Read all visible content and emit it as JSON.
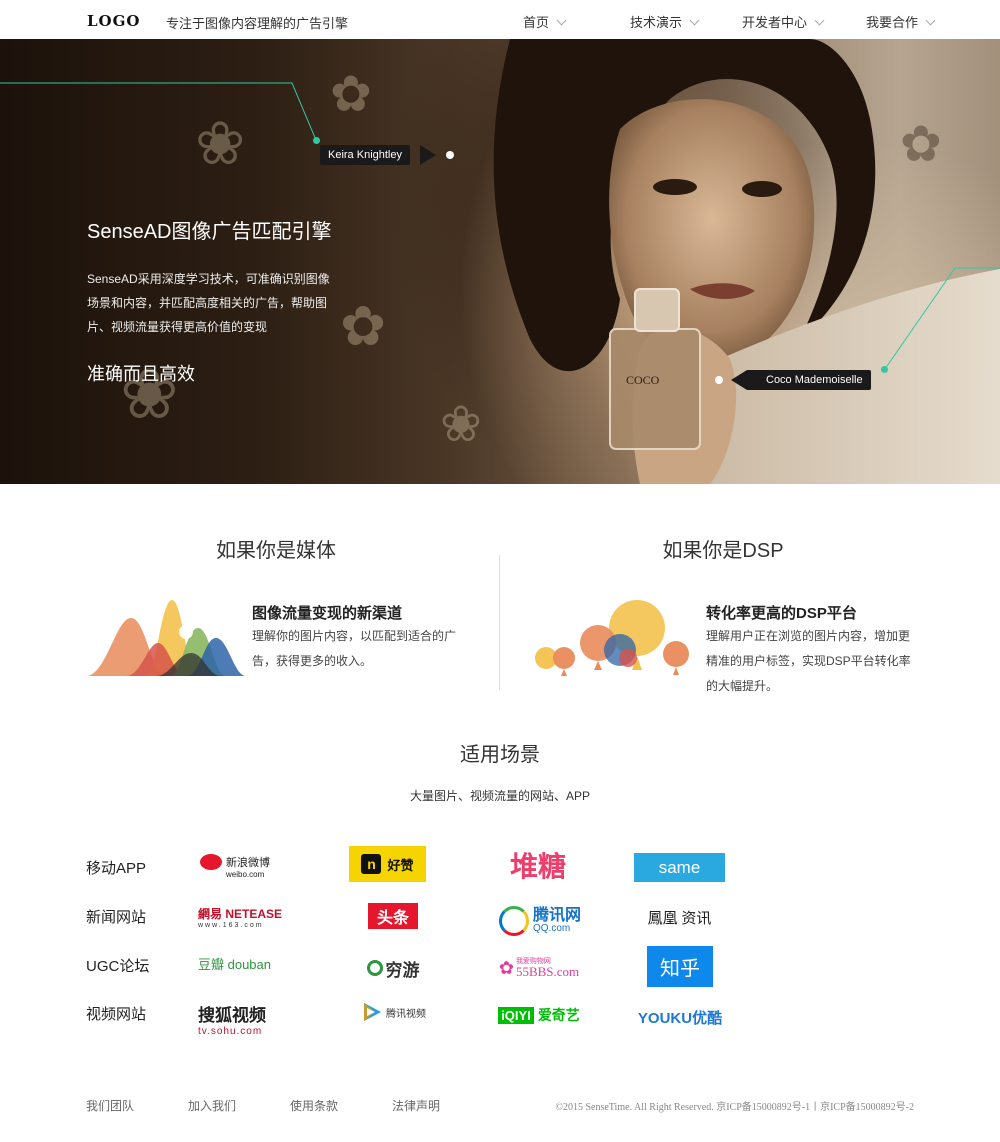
{
  "header": {
    "logo": "LOGO",
    "slogan": "专注于图像内容理解的广告引擎",
    "nav": [
      "首页",
      "技术演示",
      "开发者中心",
      "我要合作"
    ]
  },
  "hero": {
    "title": "SenseAD图像广告匹配引擎",
    "description": "SenseAD采用深度学习技术，可准确识别图像场景和内容，并匹配高度相关的广告，帮助图片、视频流量获得更高价值的变现",
    "subtitle": "准确而且高效",
    "tags": [
      "Keira Knightley",
      "Coco Mademoiselle"
    ]
  },
  "media": {
    "heading": "如果你是媒体",
    "feature_title": "图像流量变现的新渠道",
    "feature_desc": "理解你的图片内容，以匹配到适合的广告，获得更多的收入。"
  },
  "dsp": {
    "heading": "如果你是DSP",
    "feature_title": "转化率更高的DSP平台",
    "feature_desc": "理解用户正在浏览的图片内容，增加更精准的用户标签，实现DSP平台转化率的大幅提升。"
  },
  "scenes": {
    "title": "适用场景",
    "subtitle": "大量图片、视频流量的网站、APP",
    "rows": [
      {
        "label": "移动APP",
        "brands": [
          "新浪微博",
          "好赞",
          "堆糖",
          "same"
        ]
      },
      {
        "label": "新闻网站",
        "brands": [
          "網易 NETEASE",
          "头条",
          "腾讯网",
          "鳳凰 资讯"
        ]
      },
      {
        "label": "UGC论坛",
        "brands": [
          "豆瓣 douban",
          "穷游",
          "55BBS.com",
          "知乎"
        ]
      },
      {
        "label": "视频网站",
        "brands": [
          "搜狐视频",
          "腾讯视频",
          "爱奇艺",
          "YOUKU优酷"
        ]
      }
    ]
  },
  "brand_extra": {
    "weibo_sub": "weibo.com",
    "netease_sub": "www.163.com",
    "qq_sub": "QQ.com",
    "bbs_sub": "我爱购物网",
    "sohu_sub": "tv.sohu.com",
    "qiyi_mark": "iQIYI",
    "haozan_mark": "n"
  },
  "footer": {
    "links": [
      "我们团队",
      "加入我们",
      "使用条款",
      "法律声明"
    ],
    "copyright": "©2015 SenseTime. All Right Reserved. 京ICP备15000892号-1丨京ICP备15000892号-2"
  },
  "colors": {
    "accent_teal": "#35c6a3",
    "weibo_red": "#e6162d",
    "haozan_yellow": "#f5d400",
    "duitang_pink": "#ee3e6c",
    "same_blue": "#29a9e0",
    "zhihu_blue": "#0f88eb",
    "youku_blue": "#1f78d1",
    "youku_red": "#e1251b",
    "iqiyi_green": "#00be06"
  }
}
